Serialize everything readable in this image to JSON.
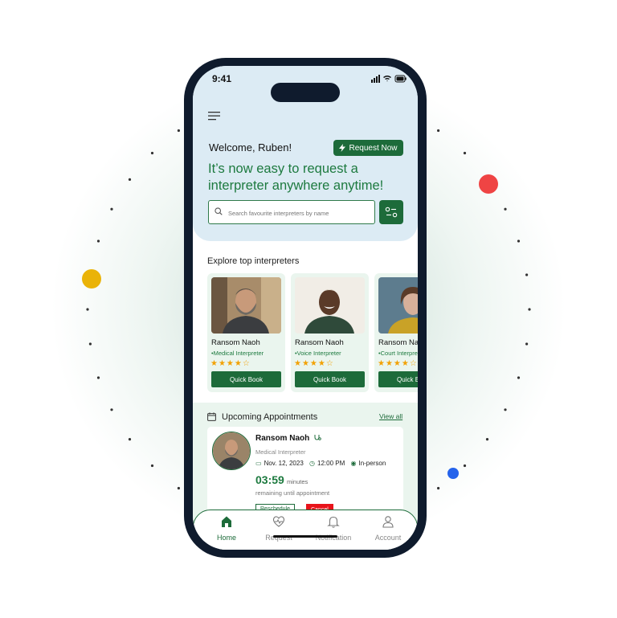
{
  "status": {
    "time": "9:41"
  },
  "header": {
    "welcome": "Welcome, Ruben!",
    "request_now": "Request Now",
    "headline": "It’s now easy to request a interpreter anywhere anytime!",
    "search_placeholder": "Search favourite interpreters by name"
  },
  "explore": {
    "title": "Explore top interpreters",
    "cards": [
      {
        "name": "Ransom Naoh",
        "role": "•Medical Interpreter",
        "rating": 4,
        "stars": "★★★★☆",
        "button": "Quick Book"
      },
      {
        "name": "Ransom Naoh",
        "role": "•Voice Interpreter",
        "rating": 4,
        "stars": "★★★★☆",
        "button": "Quick Book"
      },
      {
        "name": "Ransom Naoh",
        "role": "•Court Interpreter",
        "rating": 4,
        "stars": "★★★★☆",
        "button": "Quick Book"
      }
    ]
  },
  "appointments": {
    "title": "Upcoming Appointments",
    "view_all": "View all",
    "item": {
      "name": "Ransom Naoh",
      "role": "Medical Interpreter",
      "date": "Nov. 12, 2023",
      "time": "12:00 PM",
      "mode": "In-person",
      "countdown": "03:59",
      "countdown_unit": "minutes",
      "remaining": "remaining until appointment",
      "reschedule": "Reschedule",
      "cancel": "Cancel"
    }
  },
  "tabs": [
    {
      "label": "Home",
      "icon": "home-icon",
      "active": true
    },
    {
      "label": "Request",
      "icon": "heart-pulse-icon",
      "active": false
    },
    {
      "label": "Notification",
      "icon": "bell-icon",
      "active": false
    },
    {
      "label": "Account",
      "icon": "user-icon",
      "active": false
    }
  ],
  "colors": {
    "primary": "#1d6b3a",
    "hero_bg": "#dcebf4",
    "card_bg": "#eaf5ee",
    "star": "#f2a100",
    "danger": "#e8141b"
  }
}
